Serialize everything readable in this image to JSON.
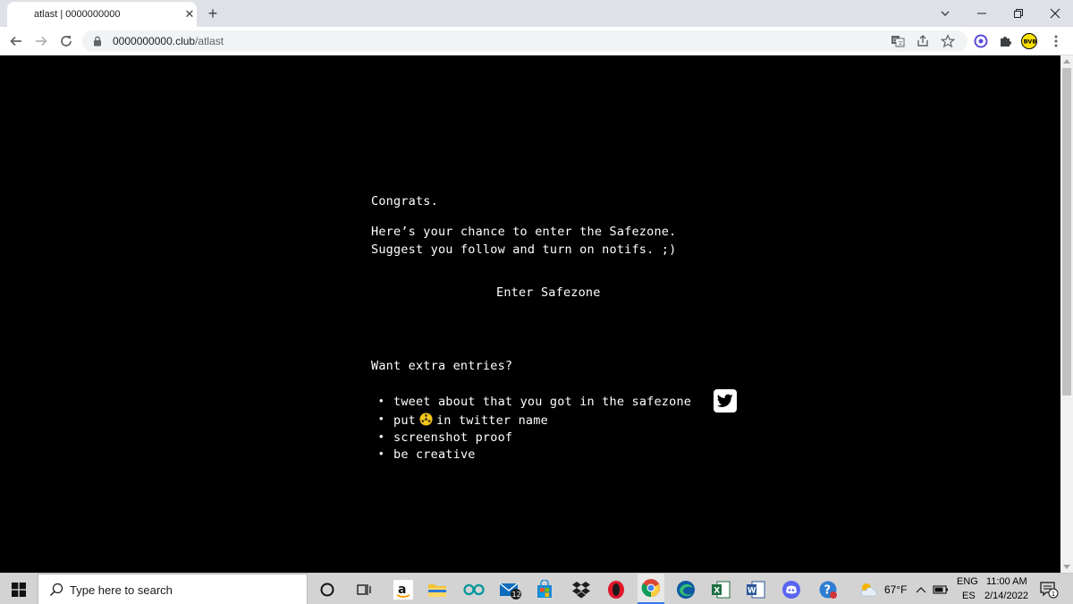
{
  "browser": {
    "tab_title": "atlast | 0000000000",
    "tab_close": "✕",
    "new_tab": "+",
    "url_domain": "0000000000.club",
    "url_path": "/atlast",
    "icons": [
      "back-icon",
      "forward-icon",
      "reload-icon",
      "lock-icon",
      "translate-icon",
      "share-icon",
      "star-icon",
      "extension-icon",
      "puzzle-icon",
      "bvb-icon",
      "menu-icon"
    ]
  },
  "page": {
    "line1": "Congrats.",
    "line2": "Here’s your chance to enter the Safezone.",
    "line3": "Suggest you follow and turn on notifs. ;)",
    "enter_link": "Enter Safezone",
    "extra_title": "Want extra entries?",
    "bullet": "•",
    "items": {
      "tweet": "tweet about that you got in the safezone",
      "put_a": "put",
      "put_b": "in twitter name",
      "screenshot": "screenshot proof",
      "creative": "be creative"
    }
  },
  "taskbar": {
    "search_placeholder": "Type here to search",
    "mail_badge": "12",
    "weather": "67°F",
    "lang_top": "ENG",
    "lang_bottom": "ES",
    "time": "11:00 AM",
    "date": "2/14/2022",
    "notif_badge": "1"
  }
}
